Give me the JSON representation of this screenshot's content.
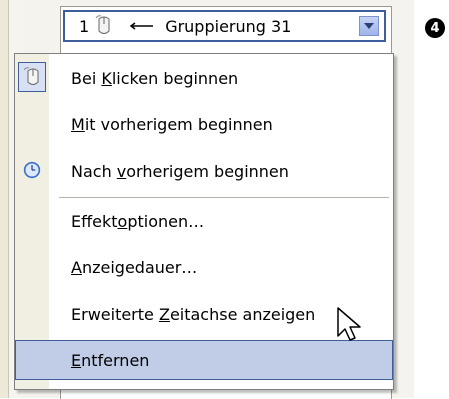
{
  "combo": {
    "number": "1",
    "name": "Gruppierung 31"
  },
  "callout_number": "4",
  "menu": {
    "items": [
      {
        "before": "Bei ",
        "accel": "K",
        "after": "licken beginnen",
        "icon": "mouse-click-icon",
        "checked": true
      },
      {
        "before": "",
        "accel": "M",
        "after": "it vorherigem beginnen",
        "icon": "",
        "checked": false
      },
      {
        "before": "Nach ",
        "accel": "v",
        "after": "orherigem beginnen",
        "icon": "clock-icon",
        "checked": false
      },
      {
        "before": "Effekt",
        "accel": "o",
        "after": "ptionen…",
        "icon": "",
        "checked": false
      },
      {
        "before": "",
        "accel": "A",
        "after": "nzeigedauer…",
        "icon": "",
        "checked": false
      },
      {
        "before": "Erweiterte ",
        "accel": "Z",
        "after": "eitachse anzeigen",
        "icon": "",
        "checked": false
      },
      {
        "before": "",
        "accel": "E",
        "after": "ntfernen",
        "icon": "",
        "checked": false,
        "hover": true
      }
    ]
  },
  "colors": {
    "accent": "#3d5d9b",
    "hover": "#c1cde6",
    "gutter": "#f1efe2"
  }
}
